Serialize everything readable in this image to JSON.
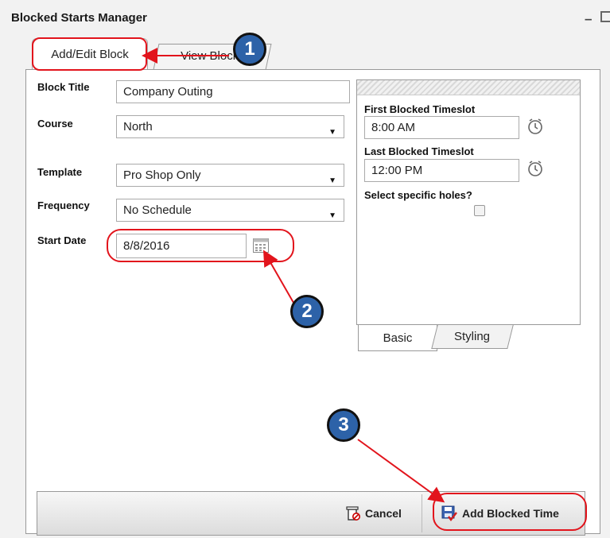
{
  "window": {
    "title": "Blocked Starts Manager"
  },
  "tabs": [
    {
      "label": "Add/Edit Block"
    },
    {
      "label": "View Blocks"
    }
  ],
  "form": {
    "block_title": {
      "label": "Block Title",
      "value": "Company Outing"
    },
    "course": {
      "label": "Course",
      "value": "North"
    },
    "template": {
      "label": "Template",
      "value": "Pro Shop Only"
    },
    "frequency": {
      "label": "Frequency",
      "value": "No Schedule"
    },
    "start_date": {
      "label": "Start Date",
      "value": "8/8/2016"
    }
  },
  "timeslots": {
    "first_label": "First Blocked Timeslot",
    "first_value": "8:00 AM",
    "last_label": "Last Blocked Timeslot",
    "last_value": "12:00 PM",
    "holes_label": "Select specific holes?"
  },
  "bottom_tabs": [
    {
      "label": "Basic"
    },
    {
      "label": "Styling"
    }
  ],
  "footer": {
    "cancel_label": "Cancel",
    "add_label": "Add Blocked Time"
  },
  "callouts": [
    "1",
    "2",
    "3"
  ],
  "colors": {
    "callout_red": "#e2141c",
    "badge_blue": "#2d62a8"
  }
}
